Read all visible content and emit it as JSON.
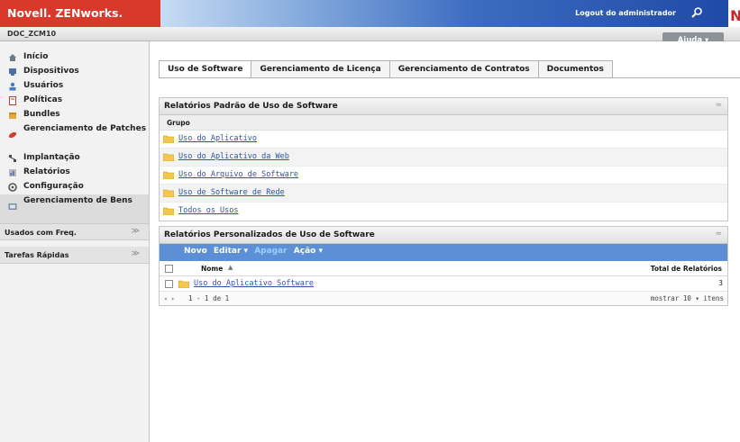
{
  "header": {
    "brand": "Novell. ZENworks.",
    "logout_label": "Logout do administrador",
    "zone": "DOC_ZCM10",
    "help_label": "Ajuda ▾",
    "accent_color": "#d8392a",
    "mark_glyph": "N"
  },
  "sidebar": {
    "items": [
      {
        "label": "Início",
        "icon": "home-icon"
      },
      {
        "label": "Dispositivos",
        "icon": "devices-icon"
      },
      {
        "label": "Usuários",
        "icon": "users-icon"
      },
      {
        "label": "Políticas",
        "icon": "policies-icon"
      },
      {
        "label": "Bundles",
        "icon": "bundles-icon"
      },
      {
        "label": "Gerenciamento de Patches",
        "icon": "patch-icon"
      },
      {
        "label": "Implantação",
        "icon": "deployment-icon"
      },
      {
        "label": "Relatórios",
        "icon": "reports-icon"
      },
      {
        "label": "Configuração",
        "icon": "configuration-icon"
      },
      {
        "label": "Gerenciamento de Bens",
        "icon": "asset-icon"
      }
    ],
    "sections": [
      {
        "label": "Usados com Freq.",
        "chevron": "≫"
      },
      {
        "label": "Tarefas Rápidas",
        "chevron": "≫"
      }
    ]
  },
  "main": {
    "tabs": [
      {
        "label": "Uso de Software"
      },
      {
        "label": "Gerenciamento de Licença"
      },
      {
        "label": "Gerenciamento de Contratos"
      },
      {
        "label": "Documentos"
      }
    ],
    "standard_panel": {
      "title": "Relatórios Padrão de Uso de Software",
      "collapse_glyph": "≈",
      "column": "Grupo",
      "rows": [
        "Uso do Aplicativo",
        "Uso do Aplicativo da Web",
        "Uso do Arquivo de Software",
        "Uso de Software de Rede",
        "Todos os Usos"
      ]
    },
    "custom_panel": {
      "title": "Relatórios Personalizados de Uso de Software",
      "collapse_glyph": "≈",
      "toolbar": {
        "new": "Novo",
        "edit": "Editar ▾",
        "delete": "Apagar",
        "action": "Ação ▾"
      },
      "col_name": "Nome",
      "sort_glyph": "▲",
      "col_total": "Total de Relatórios",
      "rows": [
        {
          "name": "Uso do Aplicativo Software",
          "count": "3"
        }
      ],
      "pager": {
        "nav": "◂ ▸",
        "range": "1 - 1 de 1",
        "show": "mostrar  10 ▾  itens"
      }
    }
  }
}
